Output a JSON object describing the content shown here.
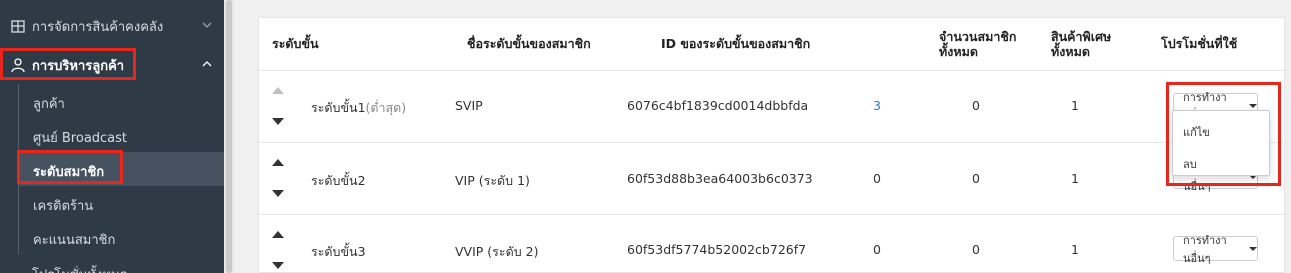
{
  "sidebar": {
    "inventory_label": "การจัดการสินค้าคงคลัง",
    "customer_mgmt_label": "การบริหารลูกค้า",
    "sub_items": [
      "ลูกค้า",
      "ศูนย์ Broadcast",
      "ระดับสมาชิก",
      "เครดิตร้าน",
      "คะแนนสมาชิก"
    ],
    "bottom_partial_label": "โปรโมชั่นทั้งหมด"
  },
  "table": {
    "headers": {
      "level": "ระดับขั้น",
      "level_name": "ชื่อระดับขั้นของสมาชิก",
      "level_id": "ID ของระดับขั้นของสมาชิก",
      "member_count_1": "จำนวนสมาชิก",
      "member_count_2": "ทั้งหมด",
      "special_1": "สินค้าพิเศษ",
      "special_2": "ทั้งหมด",
      "promo": "โปรโมชั่นที่ใช้"
    },
    "rows": [
      {
        "level": "ระดับขั้น1",
        "level_suffix": "(ต่ำสุด)",
        "name": "SVIP",
        "id": "6076c4bf1839cd0014dbbfda",
        "members": "3",
        "special": "0",
        "promo": "1",
        "action": "การทำงานอื่นๆ"
      },
      {
        "level": "ระดับขั้น2",
        "level_suffix": "",
        "name": "VIP (ระดับ 1)",
        "id": "60f53d88b3ea64003b6c0373",
        "members": "0",
        "special": "0",
        "promo": "1",
        "action": "การทำงานอื่นๆ"
      },
      {
        "level": "ระดับขั้น3",
        "level_suffix": "",
        "name": "VVIP (ระดับ 2)",
        "id": "60f53df5774b52002cb726f7",
        "members": "0",
        "special": "0",
        "promo": "1",
        "action": "การทำงานอื่นๆ"
      }
    ]
  },
  "dropdown": {
    "items": [
      "แก้ไข",
      "ลบ"
    ]
  },
  "colors": {
    "sidebar_bg": "#2f3a47",
    "highlight_red": "#e8261c",
    "link_blue": "#2d7db8"
  }
}
